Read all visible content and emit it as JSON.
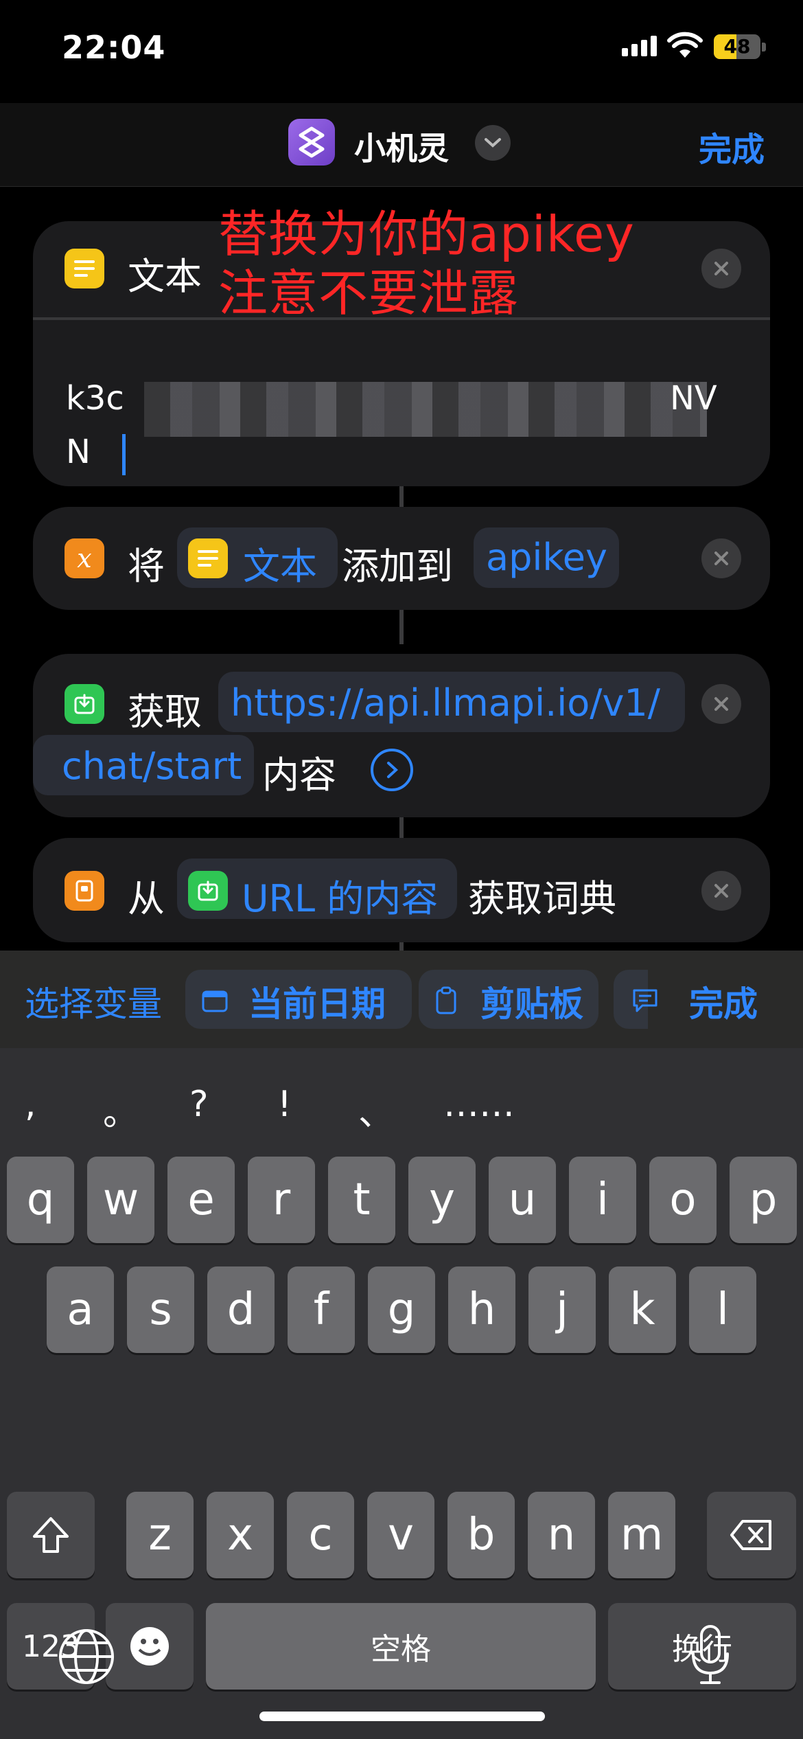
{
  "status_bar": {
    "time": "22:04",
    "battery": "48",
    "battery_level": 0.48
  },
  "nav": {
    "title": "小机灵",
    "done": "完成"
  },
  "annotation": {
    "line1": "替换为你的apikey",
    "line2": "注意不要泄露"
  },
  "card_text": {
    "title": "文本",
    "value_start": "k3c",
    "value_end": "NV",
    "value_line2": "N"
  },
  "card_set": {
    "verb": "将",
    "var_label": "文本",
    "mid": "添加到",
    "target": "apikey"
  },
  "card_get": {
    "verb": "获取",
    "url_line1": "https://api.llmapi.io/v1/",
    "url_line2": "chat/start",
    "suffix": "内容"
  },
  "card_dict": {
    "verb": "从",
    "var_label": "URL 的内容",
    "suffix": "获取词典"
  },
  "toolbar": {
    "select_var": "选择变量",
    "current_date": "当前日期",
    "clipboard": "剪贴板",
    "done": "完成"
  },
  "keyboard": {
    "punct": [
      ",",
      "。",
      "?",
      "!",
      "、",
      "……"
    ],
    "row1": [
      "q",
      "w",
      "e",
      "r",
      "t",
      "y",
      "u",
      "i",
      "o",
      "p"
    ],
    "row2": [
      "a",
      "s",
      "d",
      "f",
      "g",
      "h",
      "j",
      "k",
      "l"
    ],
    "row3": [
      "z",
      "x",
      "c",
      "v",
      "b",
      "n",
      "m"
    ],
    "num": "123",
    "space": "空格",
    "return": "换行"
  },
  "colors": {
    "accent": "#2f86ff",
    "annotation": "#ff2626",
    "card": "#1c1c1e"
  }
}
